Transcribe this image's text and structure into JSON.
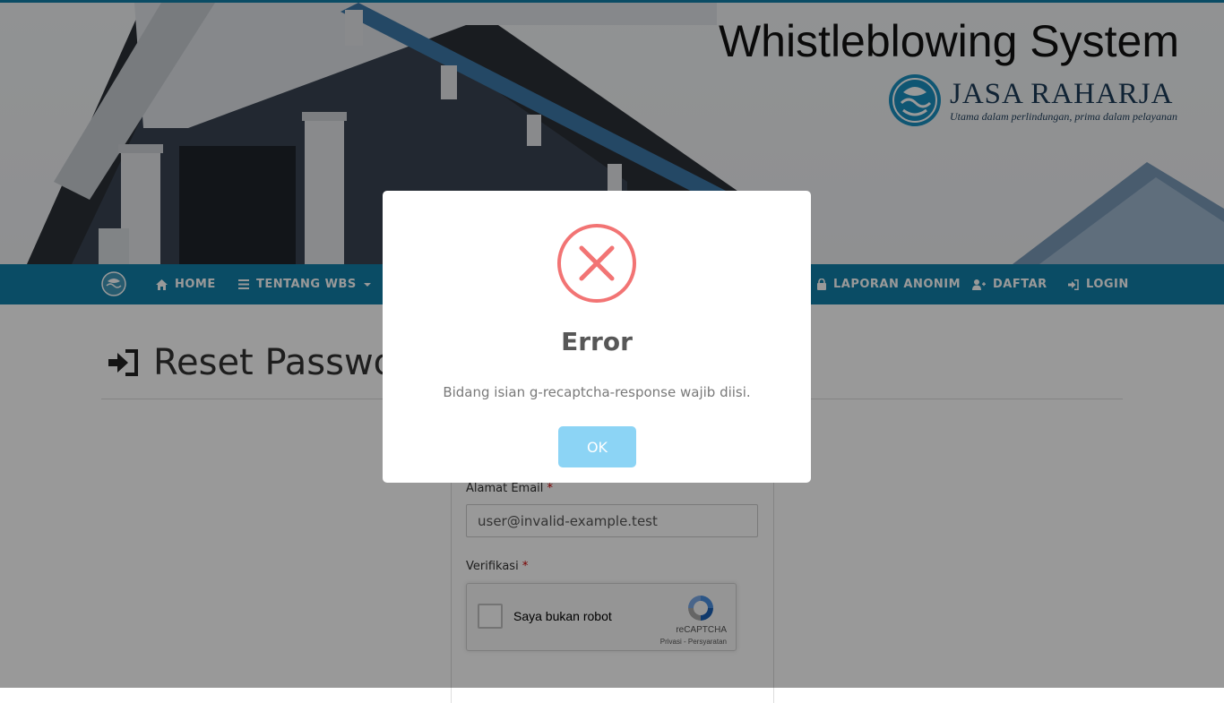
{
  "header": {
    "system_title": "Whistleblowing System",
    "brand_name": "JASA RAHARJA",
    "brand_tagline": "Utama dalam perlindungan, prima dalam pelayanan",
    "building_sign": "JASA RAHARJA"
  },
  "nav": {
    "items": [
      {
        "label": "HOME",
        "icon": "home-icon"
      },
      {
        "label": "TENTANG WBS",
        "icon": "list-icon"
      },
      {
        "label": "LAPORAN ANONIM",
        "icon": "lock-icon"
      },
      {
        "label": "DAFTAR",
        "icon": "user-plus-icon"
      },
      {
        "label": "LOGIN",
        "icon": "sign-in-icon"
      }
    ]
  },
  "page": {
    "title": "Reset Password"
  },
  "form": {
    "email_label": "Alamat Email",
    "email_value": "user@invalid-example.test",
    "verification_label": "Verifikasi",
    "required_mark": "*"
  },
  "recaptcha": {
    "checkbox_label": "Saya bukan robot",
    "brand": "reCAPTCHA",
    "links": "Privasi - Persyaratan"
  },
  "modal": {
    "title": "Error",
    "message": "Bidang isian g-recaptcha-response wajib diisi.",
    "ok_label": "OK"
  },
  "colors": {
    "nav_bg": "#127fa8",
    "error_red": "#f27474",
    "ok_button": "#8cd4f5"
  }
}
